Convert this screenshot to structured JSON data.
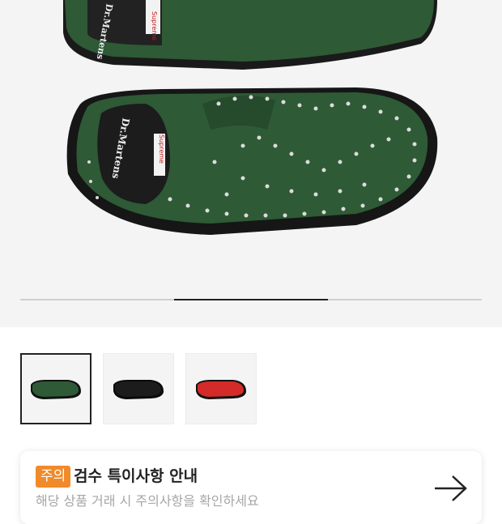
{
  "gallery": {
    "images": [
      {
        "name": "green-loafer",
        "color": "#2e5a36"
      },
      {
        "name": "black-loafer",
        "color": "#1c1c1c"
      },
      {
        "name": "red-loafer",
        "color": "#d32a2a"
      }
    ],
    "active_page": 2,
    "page_count": 3,
    "selected_thumbnail": 1
  },
  "notice": {
    "badge": "주의",
    "title": "검수 특이사항 안내",
    "subtitle": "해당 상품 거래 시 주의사항을 확인하세요",
    "arrow_icon": "arrow-right-icon"
  }
}
